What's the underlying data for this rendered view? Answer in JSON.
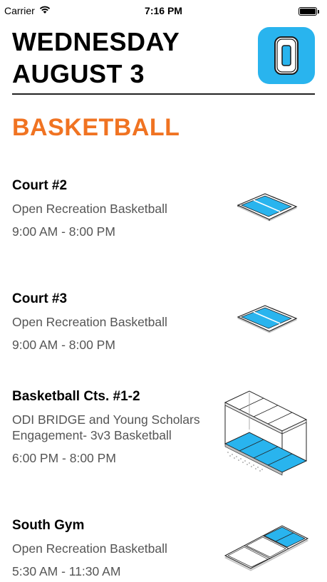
{
  "status_bar": {
    "carrier": "Carrier",
    "time": "7:16 PM"
  },
  "header": {
    "weekday": "WEDNESDAY",
    "date": "AUGUST 3",
    "logo_letter": "O"
  },
  "sport": "BASKETBALL",
  "colors": {
    "accent_orange": "#f07322",
    "court_blue": "#29b4ee",
    "logo_blue": "#29b4ee"
  },
  "entries": [
    {
      "name": "Court #2",
      "description": "Open Recreation Basketball",
      "time": "9:00 AM - 8:00 PM",
      "icon": "single-court-icon"
    },
    {
      "name": "Court #3",
      "description": "Open Recreation Basketball",
      "time": "9:00 AM - 8:00 PM",
      "icon": "single-court-icon"
    },
    {
      "name": "Basketball Cts. #1-2",
      "description": "ODI BRIDGE and Young Scholars Engagement- 3v3 Basketball",
      "time": "6:00 PM - 8:00 PM",
      "icon": "multi-level-courts-icon"
    },
    {
      "name": "South Gym",
      "description": "Open Recreation Basketball",
      "time": "5:30 AM - 11:30 AM",
      "icon": "gym-courts-icon"
    }
  ]
}
